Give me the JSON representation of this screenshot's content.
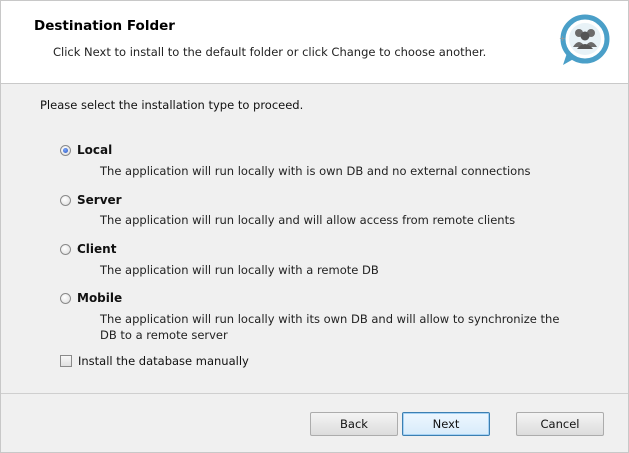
{
  "header": {
    "title": "Destination Folder",
    "subtitle": "Click Next to install to the default folder or click Change to choose another."
  },
  "prompt": "Please select the installation type to proceed.",
  "options": [
    {
      "label": "Local",
      "description": "The application will run locally with is own DB and no external connections",
      "selected": true
    },
    {
      "label": "Server",
      "description": "The application will run locally and will allow access from remote clients",
      "selected": false
    },
    {
      "label": "Client",
      "description": "The application will run locally with a remote DB",
      "selected": false
    },
    {
      "label": "Mobile",
      "description": "The application will run locally with its own DB and will allow to synchronize the DB to a remote server",
      "selected": false
    }
  ],
  "checkbox": {
    "label": "Install the database manually",
    "checked": false
  },
  "buttons": {
    "back": "Back",
    "next": "Next",
    "cancel": "Cancel"
  },
  "logo_icon": "community-chat-icon",
  "colors": {
    "logo_accent": "#4a9fc8",
    "default_button_border": "#3c7fb1"
  }
}
